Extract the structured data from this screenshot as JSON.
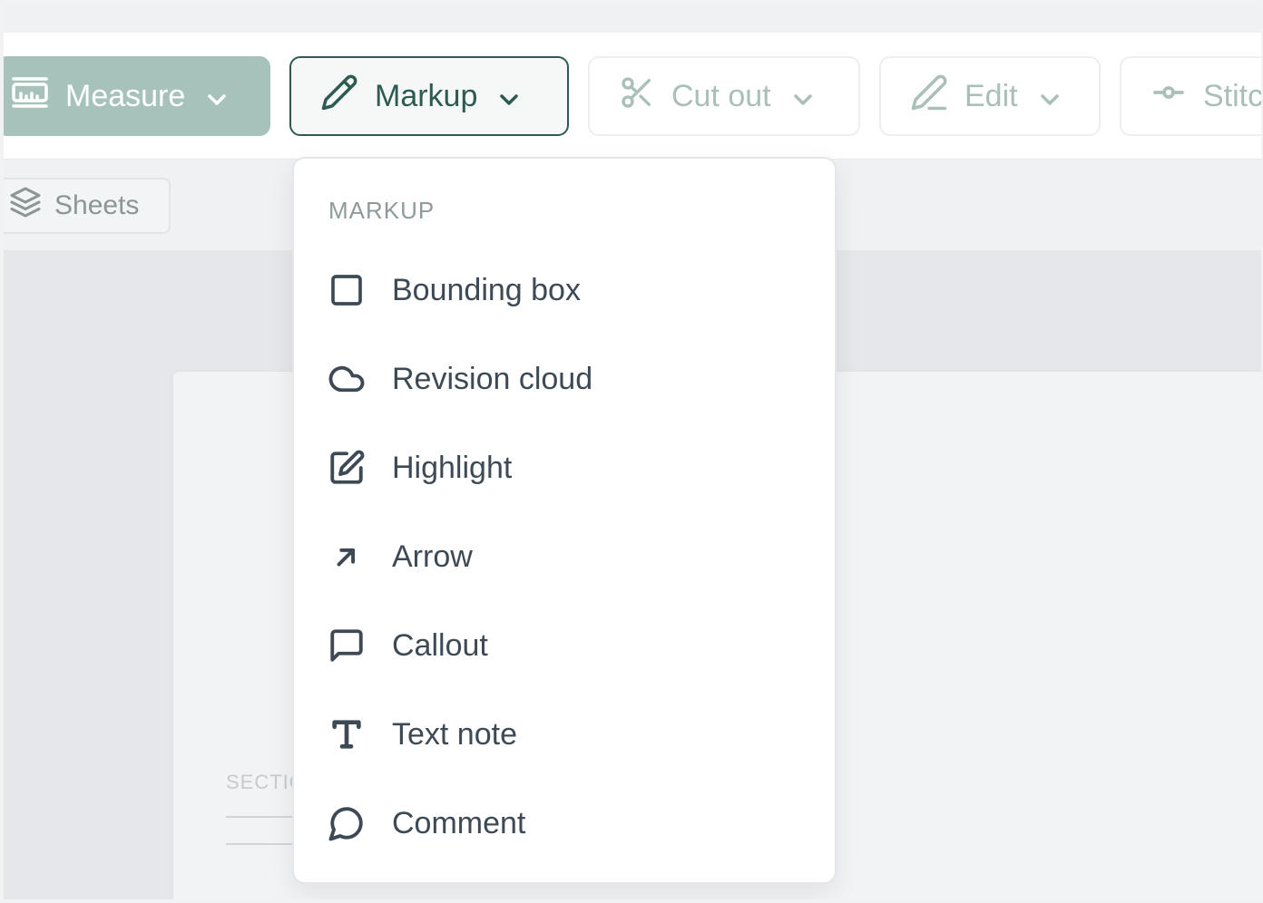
{
  "toolbar": {
    "measure": {
      "label": "Measure",
      "icon": "ruler-icon"
    },
    "markup": {
      "label": "Markup",
      "icon": "pencil-icon"
    },
    "cut_out": {
      "label": "Cut out",
      "icon": "scissors-icon"
    },
    "edit": {
      "label": "Edit",
      "icon": "pen-icon"
    },
    "stitch": {
      "label": "Stitc",
      "icon": "commit-icon"
    }
  },
  "sheets": {
    "label": "Sheets",
    "icon": "layers-icon"
  },
  "canvas": {
    "section_label": "SECTIO"
  },
  "dropdown": {
    "header": "MARKUP",
    "items": [
      {
        "label": "Bounding box",
        "icon": "square-icon"
      },
      {
        "label": "Revision cloud",
        "icon": "cloud-icon"
      },
      {
        "label": "Highlight",
        "icon": "edit-square-icon"
      },
      {
        "label": "Arrow",
        "icon": "arrow-up-right-icon"
      },
      {
        "label": "Callout",
        "icon": "message-square-icon"
      },
      {
        "label": "Text note",
        "icon": "type-icon"
      },
      {
        "label": "Comment",
        "icon": "message-circle-icon"
      }
    ]
  },
  "colors": {
    "accent": "#2d5a51",
    "measure_bg": "#a6c2bb",
    "muted_text": "#a9bfb8",
    "menu_text": "#3d4a55"
  }
}
